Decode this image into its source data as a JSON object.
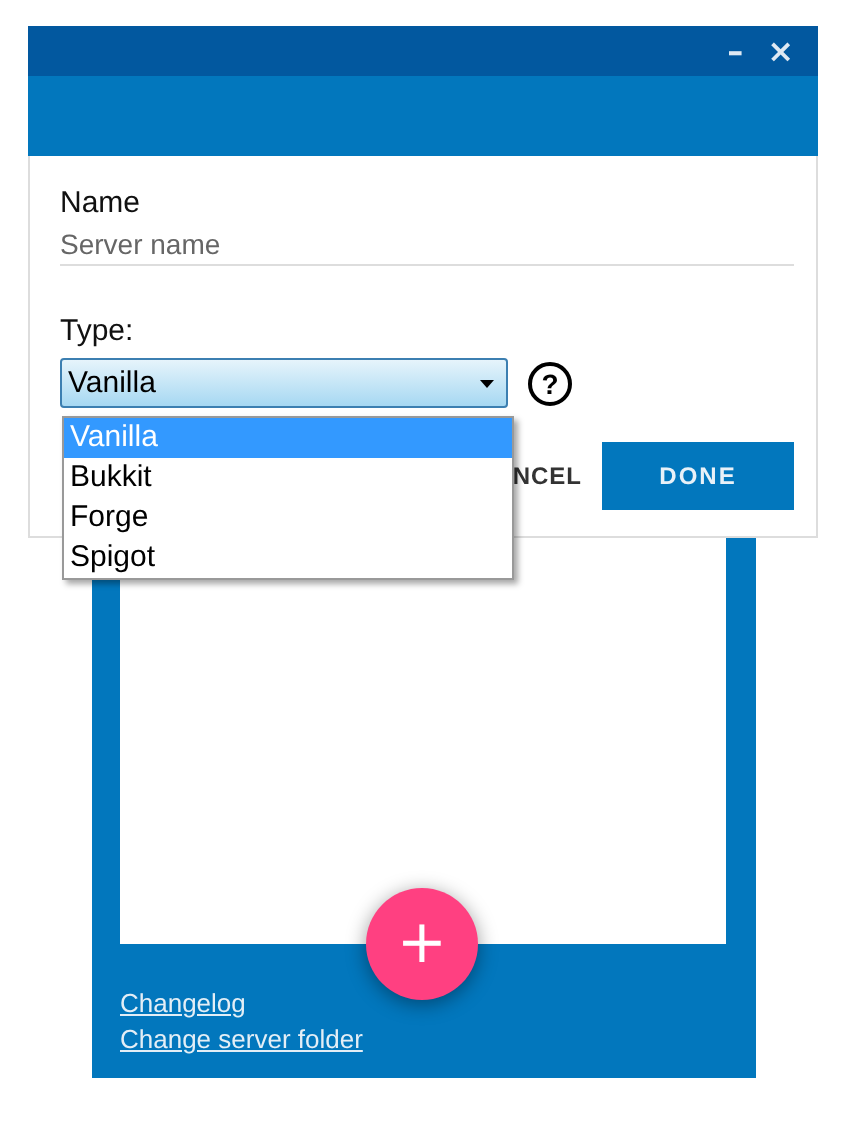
{
  "window": {
    "minimize": "–",
    "close": "×"
  },
  "dialog": {
    "name_label": "Name",
    "name_placeholder": "Server name",
    "type_label": "Type:",
    "type_value": "Vanilla",
    "help": "?",
    "options": [
      {
        "label": "Vanilla",
        "selected": true
      },
      {
        "label": "Bukkit",
        "selected": false
      },
      {
        "label": "Forge",
        "selected": false
      },
      {
        "label": "Spigot",
        "selected": false
      }
    ],
    "buttons": [
      "NCEL",
      "DONE"
    ]
  },
  "links": [
    "Changelog",
    "Change server folder"
  ],
  "fab": "+"
}
